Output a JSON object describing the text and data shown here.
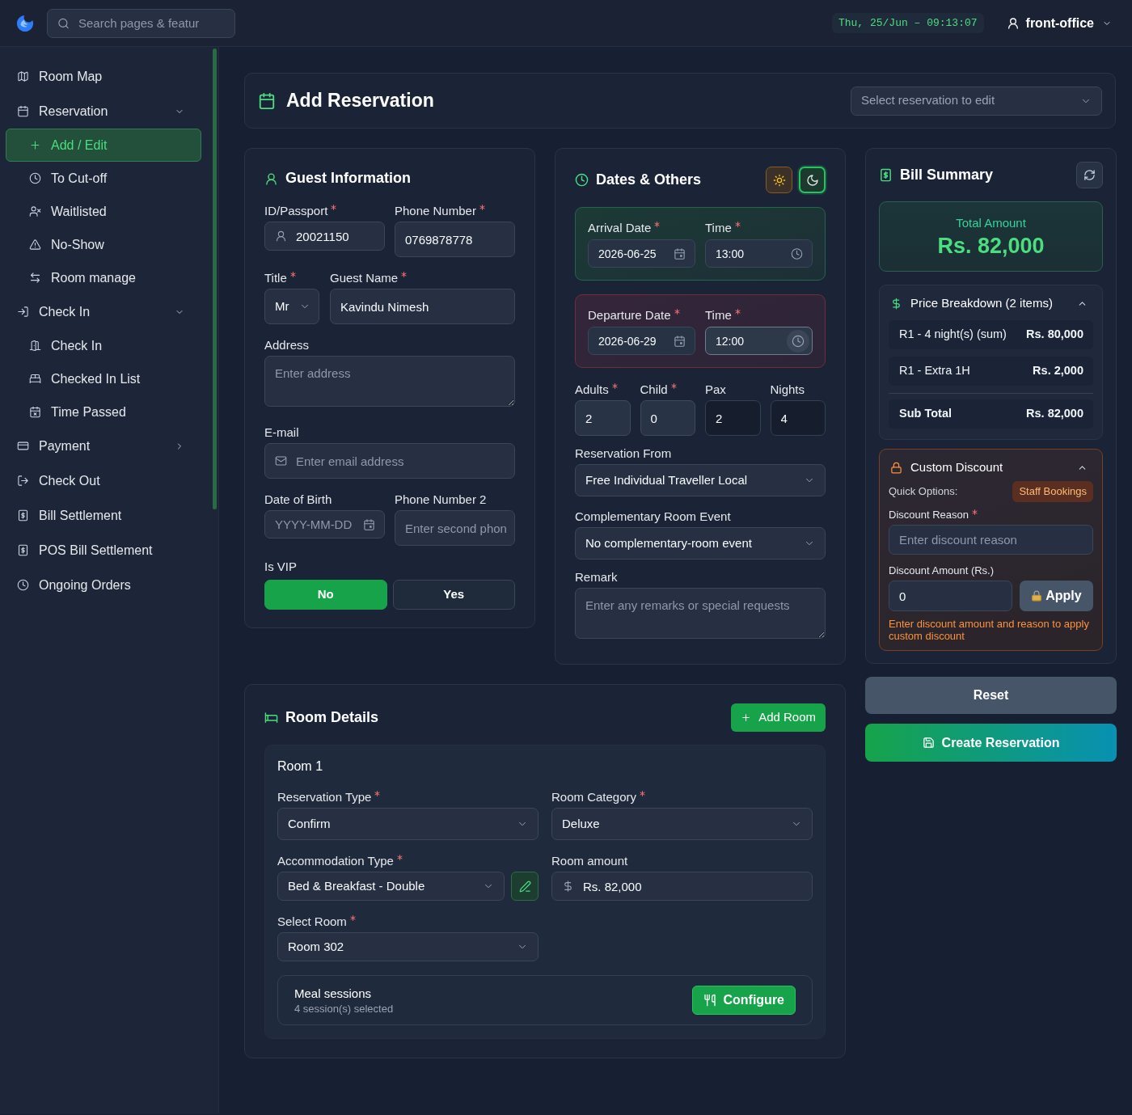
{
  "top_bar": {
    "search": {
      "placeholder": "Search pages & featur"
    },
    "clock": "Thu, 25/Jun – 09:13:07",
    "user": "front-office"
  },
  "sidebar": {
    "items": [
      {
        "label": "Room Map",
        "selected": false
      },
      {
        "label": "Reservation",
        "selected": false,
        "expanded": true,
        "children": [
          {
            "label": "Add / Edit",
            "selected": true
          },
          {
            "label": "To Cut-off",
            "selected": false
          },
          {
            "label": "Waitlisted",
            "selected": false
          },
          {
            "label": "No-Show",
            "selected": false
          },
          {
            "label": "Room manage",
            "selected": false
          }
        ]
      },
      {
        "label": "Check In",
        "selected": false,
        "expanded": true,
        "children": [
          {
            "label": "Check In",
            "selected": false
          },
          {
            "label": "Checked In List",
            "selected": false
          },
          {
            "label": "Time Passed",
            "selected": false
          }
        ]
      },
      {
        "label": "Payment",
        "selected": false,
        "expanded": false
      },
      {
        "label": "Check Out",
        "selected": false
      },
      {
        "label": "Bill Settlement",
        "selected": false
      },
      {
        "label": "POS Bill Settlement",
        "selected": false
      },
      {
        "label": "Ongoing Orders",
        "selected": false
      }
    ]
  },
  "page_header": {
    "title": "Add Reservation",
    "reservation_select": {
      "placeholder": "Select reservation to edit"
    }
  },
  "guest_information": {
    "title": "Guest Information",
    "id_passport": {
      "label": "ID/Passport",
      "required": true,
      "value": "20021150"
    },
    "phone_number": {
      "label": "Phone Number",
      "required": true,
      "value": "0769878778"
    },
    "title_field": {
      "label": "Title",
      "required": true,
      "value": "Mr"
    },
    "guest_name": {
      "label": "Guest Name",
      "required": true,
      "value": "Kavindu Nimesh"
    },
    "address": {
      "label": "Address",
      "placeholder": "Enter address"
    },
    "email": {
      "label": "E-mail",
      "placeholder": "Enter email address"
    },
    "date_of_birth": {
      "label": "Date of Birth",
      "placeholder": "YYYY-MM-DD"
    },
    "phone_number_2": {
      "label": "Phone Number 2",
      "placeholder": "Enter second phon"
    },
    "vip": {
      "label": "Is VIP",
      "options": [
        {
          "label": "No",
          "selected": true
        },
        {
          "label": "Yes",
          "selected": false
        }
      ]
    }
  },
  "dates": {
    "title": "Dates & Others",
    "theme_buttons": [
      {
        "kind": "light",
        "selected": false
      },
      {
        "kind": "dark",
        "selected": true
      }
    ],
    "stay": [
      {
        "kind": "arrival",
        "date_label": "Arrival Date",
        "date_required": true,
        "date": "2026-06-25",
        "time_label": "Time",
        "time_required": true,
        "time": "13:00",
        "time_focused": false
      },
      {
        "kind": "departure",
        "date_label": "Departure Date",
        "date_required": true,
        "date": "2026-06-29",
        "time_label": "Time",
        "time_required": true,
        "time": "12:00",
        "time_focused": true
      }
    ],
    "counts": [
      {
        "label": "Adults",
        "required": true,
        "value": "2",
        "readonly": false
      },
      {
        "label": "Child",
        "required": true,
        "value": "0",
        "readonly": false
      },
      {
        "label": "Pax",
        "required": false,
        "value": "2",
        "readonly": true
      },
      {
        "label": "Nights",
        "required": false,
        "value": "4",
        "readonly": true
      }
    ],
    "reservation_from": {
      "label": "Reservation From",
      "value": "Free Individual Traveller Local"
    },
    "complementary_room_event": {
      "label": "Complementary Room Event",
      "value": "No complementary-room event"
    },
    "remark": {
      "label": "Remark",
      "placeholder": "Enter any remarks or special requests"
    }
  },
  "bill_summary": {
    "title": "Bill Summary",
    "total_label": "Total Amount",
    "total": "Rs. 82,000",
    "price_breakdown": {
      "title": "Price Breakdown (2 items)",
      "expanded": true,
      "items": [
        {
          "label": "R1 - 4 night(s) (sum)",
          "amount": "Rs. 80,000"
        },
        {
          "label": "R1 - Extra 1H",
          "amount": "Rs. 2,000"
        }
      ],
      "subtotal": {
        "label": "Sub Total",
        "amount": "Rs. 82,000"
      }
    },
    "custom_discount": {
      "title": "Custom Discount",
      "expanded": true,
      "quick_options_label": "Quick Options:",
      "quick_options": [
        "Staff Bookings"
      ],
      "reason": {
        "label": "Discount Reason",
        "required": true,
        "placeholder": "Enter discount reason"
      },
      "amount": {
        "label": "Discount Amount (Rs.)",
        "value": "0"
      },
      "apply_button": "Apply",
      "hint": "Enter discount amount and reason to apply custom discount"
    }
  },
  "actions": {
    "reset": "Reset",
    "create": "Create Reservation"
  },
  "room_details": {
    "title": "Room Details",
    "add_button": "Add Room",
    "rooms": [
      {
        "title": "Room 1",
        "reservation_type": {
          "label": "Reservation Type",
          "required": true,
          "value": "Confirm"
        },
        "room_category": {
          "label": "Room Category",
          "required": true,
          "value": "Deluxe"
        },
        "accommodation_type": {
          "label": "Accommodation Type",
          "required": true,
          "value": "Bed & Breakfast - Double"
        },
        "room_amount": {
          "label": "Room amount",
          "value": "Rs. 82,000"
        },
        "select_room": {
          "label": "Select Room",
          "required": true,
          "value": "Room 302"
        },
        "meal_sessions": {
          "title": "Meal sessions",
          "summary": "4 session(s) selected",
          "button": "Configure"
        }
      }
    ]
  }
}
